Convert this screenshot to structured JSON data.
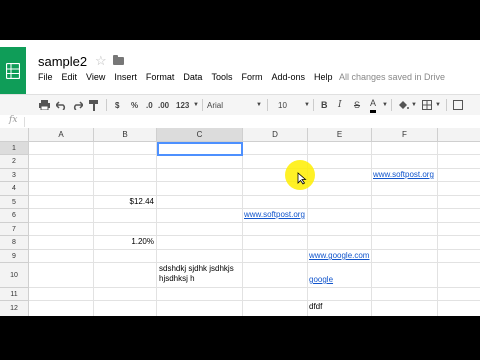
{
  "app": {
    "title": "sample2",
    "status": "All changes saved in Drive"
  },
  "menu": [
    "File",
    "Edit",
    "View",
    "Insert",
    "Format",
    "Data",
    "Tools",
    "Form",
    "Add-ons",
    "Help"
  ],
  "toolbar": {
    "currency": "$",
    "percent": "%",
    "dec_less": ".0",
    "dec_more": ".00",
    "more_formats": "123",
    "font": "Arial",
    "font_size": "10",
    "bold": "B",
    "italic": "I",
    "strike": "S",
    "text_color": "A",
    "text_color_value": "#000000"
  },
  "formula_bar": {
    "fx": "fx",
    "value": ""
  },
  "columns": [
    "A",
    "B",
    "C",
    "D",
    "E",
    "F"
  ],
  "rows": [
    "1",
    "2",
    "3",
    "4",
    "5",
    "6",
    "7",
    "8",
    "9",
    "10",
    "11",
    "12"
  ],
  "cells": {
    "F3": "www.softpost.org",
    "B5": "$12.44",
    "D6": "www.softpost.org",
    "B8": "1.20%",
    "E9": "www.google.com",
    "C10": "sdshdkj sjdhk jsdhkjs hjsdhksj h",
    "E10": "google",
    "E12": "dfdf"
  },
  "selection": {
    "cell": "C1",
    "column": "C",
    "row": "1"
  },
  "colors": {
    "brand": "#0f9d58",
    "link": "#1155cc",
    "selection": "#4d90fe"
  }
}
